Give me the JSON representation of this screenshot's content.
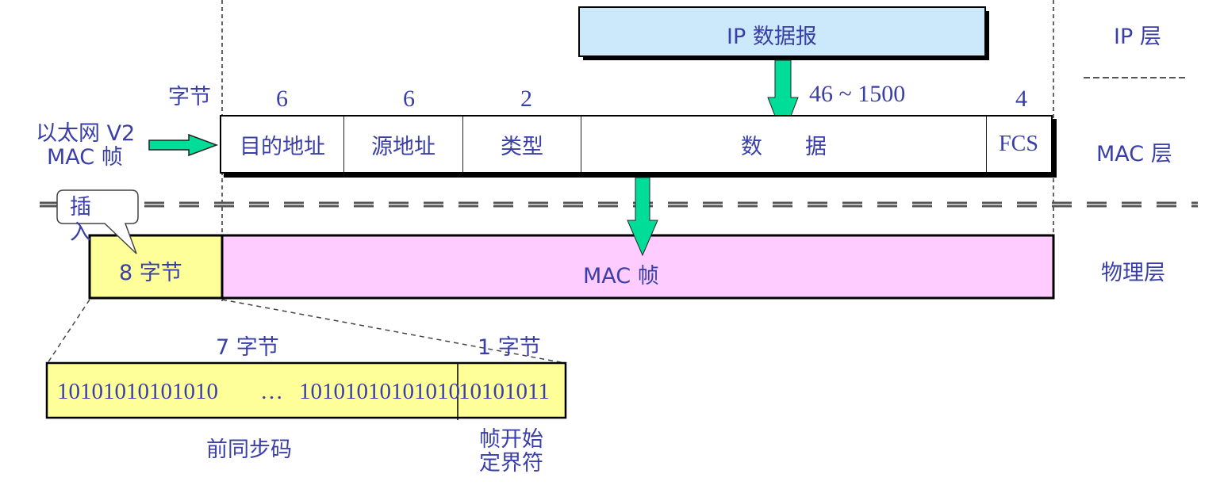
{
  "layers": {
    "ip": "IP 层",
    "mac": "MAC 层",
    "physical": "物理层"
  },
  "ip_datagram": {
    "label": "IP 数据报",
    "color": "#cce9fb"
  },
  "frame_label": {
    "line1": "以太网 V2",
    "line2": "MAC 帧"
  },
  "byte_unit": "字节",
  "mac_frame": {
    "fields": [
      {
        "name": "目的地址",
        "bytes": "6"
      },
      {
        "name": "源地址",
        "bytes": "6"
      },
      {
        "name": "类型",
        "bytes": "2"
      },
      {
        "name": "数　　据",
        "bytes": "46 ~ 1500"
      },
      {
        "name": "FCS",
        "bytes": "4"
      }
    ]
  },
  "physical": {
    "preamble_label": "8 字节",
    "preamble_color": "#ffff99",
    "mac_frame_label": "MAC 帧",
    "mac_frame_color": "#ffccff",
    "callout": "插入"
  },
  "preamble_detail": {
    "left_bytes": "7 字节",
    "right_bytes": "1 字节",
    "bits_left": "10101010101010",
    "ellipsis": "…",
    "bits_mid": "10101010101010",
    "bits_right": "10101011",
    "left_caption": "前同步码",
    "right_caption_line1": "帧开始",
    "right_caption_line2": "定界符"
  },
  "colors": {
    "arrow": "#00dd99",
    "text": "#3a3fa8"
  }
}
